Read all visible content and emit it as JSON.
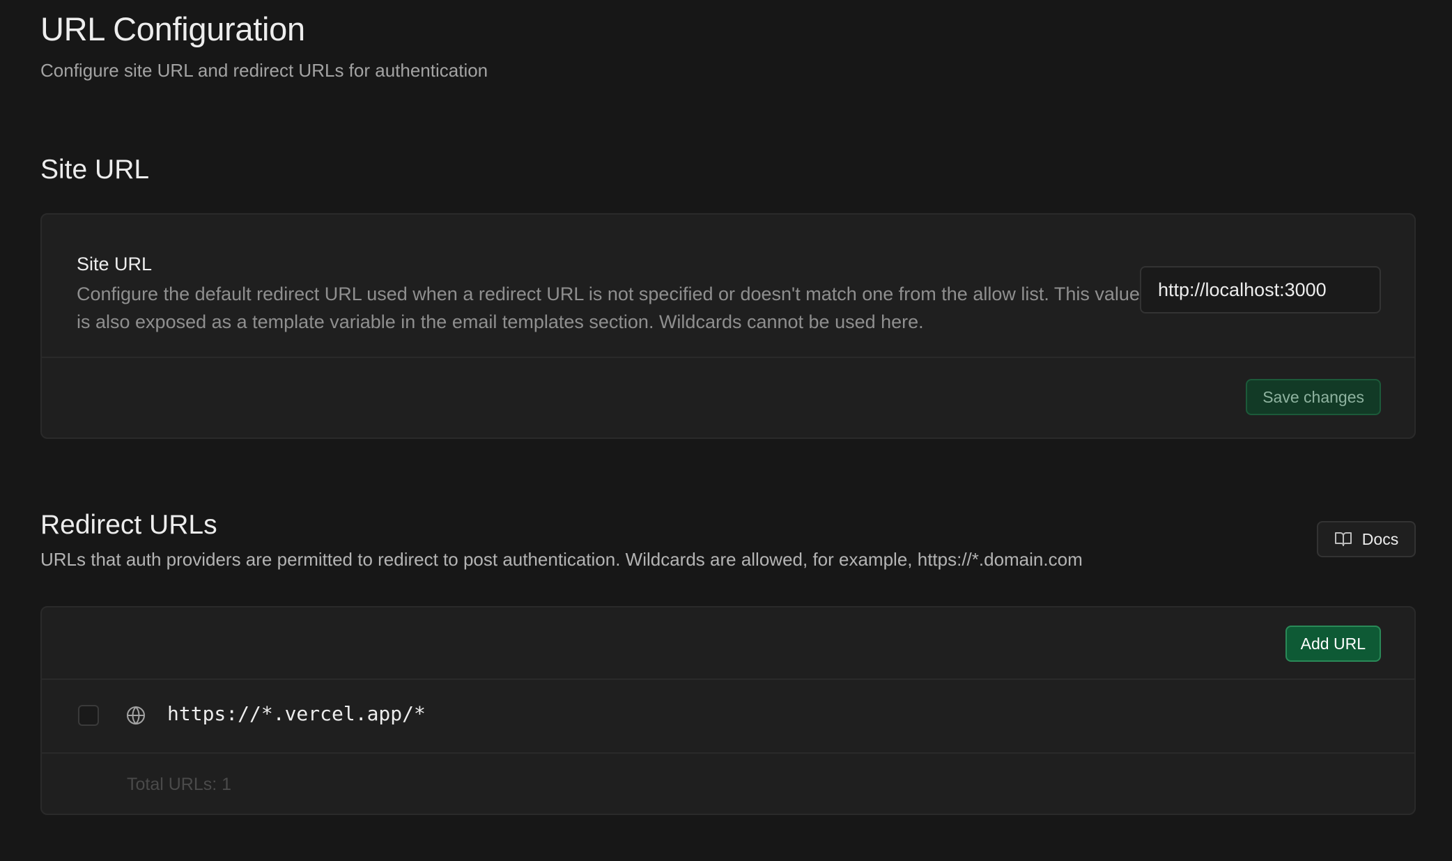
{
  "header": {
    "title": "URL Configuration",
    "subtitle": "Configure site URL and redirect URLs for authentication"
  },
  "site_url_section": {
    "title": "Site URL",
    "field_label": "Site URL",
    "description": "Configure the default redirect URL used when a redirect URL is not specified or doesn't match one from the allow list. This value is also exposed as a template variable in the email templates section. Wildcards cannot be used here.",
    "value": "http://localhost:3000",
    "save_label": "Save changes"
  },
  "redirect_section": {
    "title": "Redirect URLs",
    "description": "URLs that auth providers are permitted to redirect to post authentication. Wildcards are allowed, for example, https://*.domain.com",
    "docs_label": "Docs",
    "add_label": "Add URL",
    "urls": [
      {
        "url": "https://*.vercel.app/*",
        "icon": "globe-icon"
      }
    ],
    "total_label": "Total URLs: 1"
  },
  "colors": {
    "background": "#171717",
    "card": "#1f1f1f",
    "accent": "#0e5a35",
    "border": "#2a2a2a"
  }
}
